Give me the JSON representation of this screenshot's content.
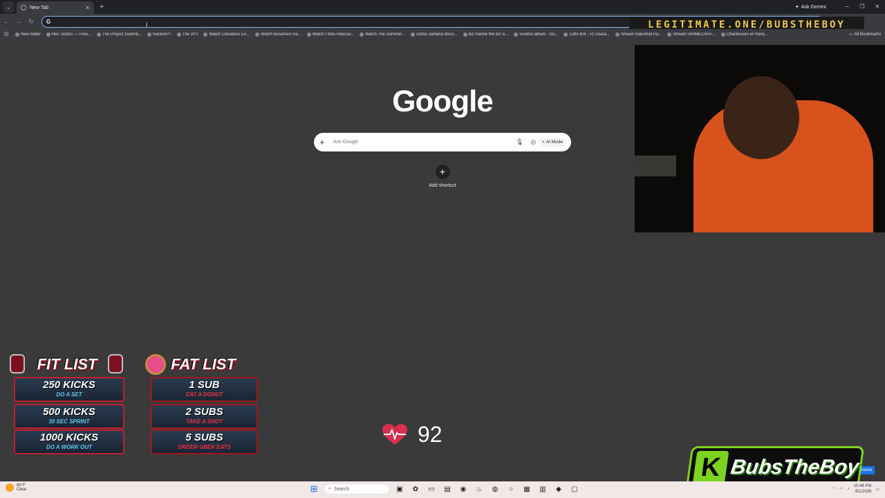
{
  "browser": {
    "tab_title": "New Tab",
    "ask_gemini": "Ask Gemini",
    "omnibox_icon": "G"
  },
  "stream_overlay_url": "LEGITIMATE.ONE/BUBSTHEBOY",
  "bookmarks": [
    "New folder",
    "Hex Tactics — Free...",
    "The Project Gutenb...",
    "NanoGPT",
    "The 20's",
    "Watch Clevatess En...",
    "Watch Busamen Ga...",
    "Watch I Was Reincar...",
    "Watch The Summer...",
    "carlos santana disco...",
    "biz markie the biz is...",
    "voodoo album - Go...",
    "Lotto Bot - #1 Givea...",
    "Stream Industrial Pa...",
    "Stream GRIMECRAF...",
    "Chanteuses en franç..."
  ],
  "all_bookmarks": "All Bookmarks",
  "google": {
    "logo": "Google",
    "search_placeholder": "Ask Google",
    "ai_mode": "AI Mode",
    "add_shortcut": "Add shortcut"
  },
  "fit_list": {
    "title": "FIT LIST",
    "items": [
      {
        "big": "250 KICKS",
        "small": "DO A SET"
      },
      {
        "big": "500 KICKS",
        "small": "30 SEC SPRINT"
      },
      {
        "big": "1000 KICKS",
        "small": "DO A WORK OUT"
      }
    ]
  },
  "fat_list": {
    "title": "FAT LIST",
    "items": [
      {
        "big": "1 SUB",
        "small": "EAT A DONUT"
      },
      {
        "big": "2 SUBS",
        "small": "TAKE A SHOT"
      },
      {
        "big": "5 SUBS",
        "small": "ORDER UBER EATS"
      }
    ]
  },
  "heart_rate": "92",
  "brand": {
    "k": "K",
    "name": "BubsTheBoy"
  },
  "chrome_badge": "ize Chrome",
  "taskbar": {
    "weather_temp": "84°F",
    "weather_cond": "Clear",
    "search": "Search",
    "time": "10:48 PM",
    "date": "8/1/2026"
  },
  "colors": {
    "accent": "#8ab4f8",
    "overlay_text": "#f0c94d",
    "brand_green": "#7ed321"
  }
}
